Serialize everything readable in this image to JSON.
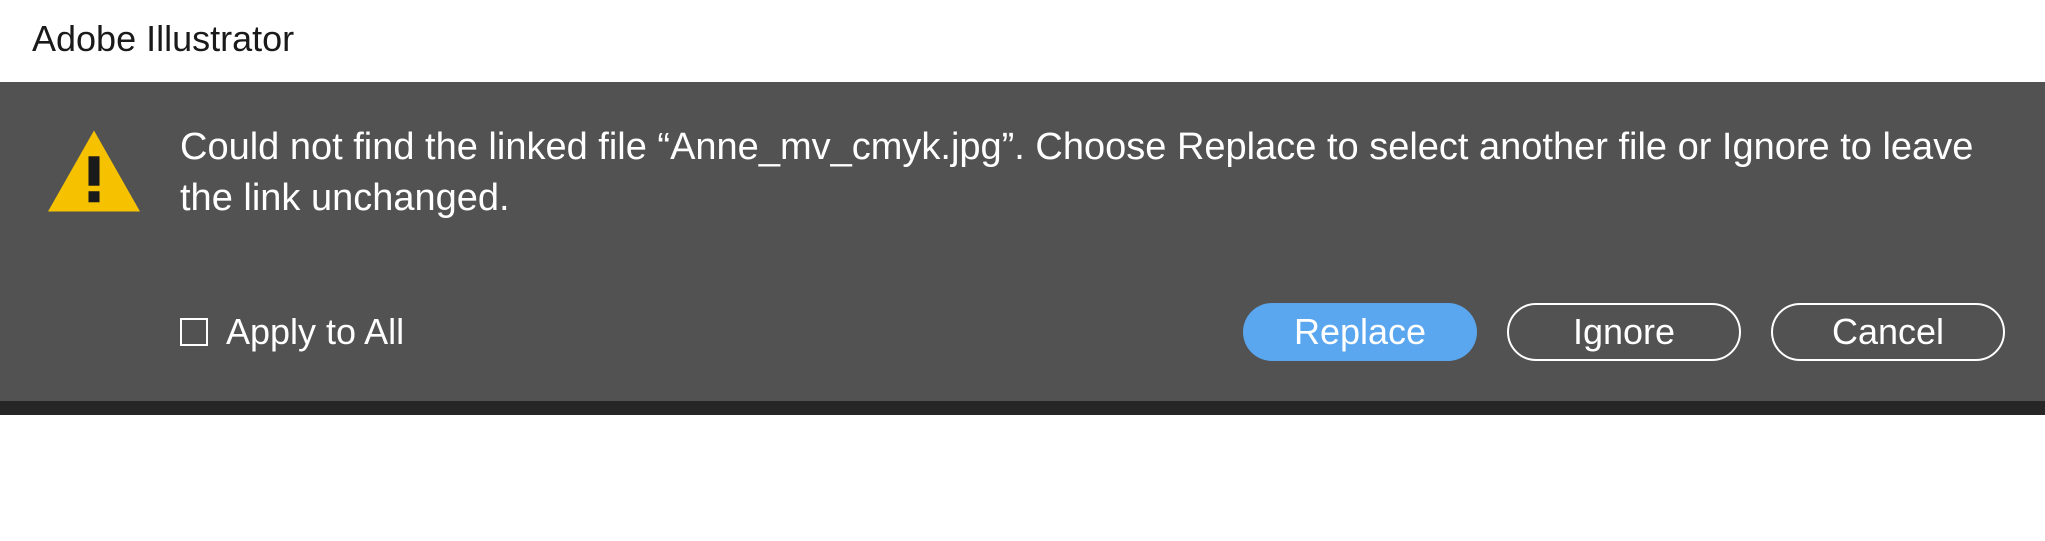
{
  "window": {
    "title": "Adobe Illustrator"
  },
  "dialog": {
    "message": "Could not find the linked file “Anne_mv_cmyk.jpg”. Choose Replace to select another file or Ignore to leave the link unchanged.",
    "apply_to_all_label": "Apply to All",
    "buttons": {
      "replace": "Replace",
      "ignore": "Ignore",
      "cancel": "Cancel"
    }
  }
}
